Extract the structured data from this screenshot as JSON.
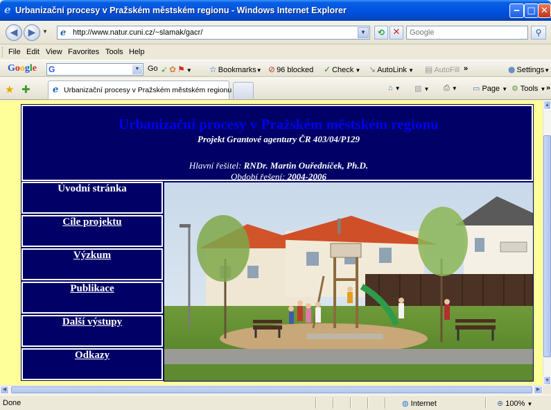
{
  "window": {
    "title": "Urbanizační procesy v Pražském městském regionu - Windows Internet Explorer",
    "minimize": "‒",
    "maximize": "□",
    "close": "✕"
  },
  "address": {
    "url": "http://www.natur.cuni.cz/~slamak/gacr/",
    "search_placeholder": "Google"
  },
  "menu": [
    "File",
    "Edit",
    "View",
    "Favorites",
    "Tools",
    "Help"
  ],
  "google_toolbar": {
    "logo": "Google",
    "go": "Go",
    "bookmarks": "Bookmarks",
    "blocked": "96 blocked",
    "check": "Check",
    "autolink": "AutoLink",
    "autofill": "AutoFill",
    "more": "»",
    "settings": "Settings"
  },
  "tabs": {
    "active_title": "Urbanizační procesy v Pražském městském regionu",
    "page": "Page",
    "tools": "Tools",
    "more": "»"
  },
  "page": {
    "title": "Urbanizační procesy v Pražském městském regionu",
    "subtitle": "Projekt Grantové agentury ČR 403/04/P129",
    "investigator_label": "Hlavní řešitel: ",
    "investigator": "RNDr. Martin Ouředníček, Ph.D.",
    "period_label": "Období řešení: ",
    "period": "2004-2006",
    "nav": [
      {
        "label": "Úvodní stránka"
      },
      {
        "label": "Cíle projektu"
      },
      {
        "label": "Výzkum"
      },
      {
        "label": "Publikace"
      },
      {
        "label": "Další výstupy"
      },
      {
        "label": "Odkazy"
      }
    ]
  },
  "status": {
    "text": "Done",
    "zone": "Internet",
    "zoom": "100%"
  },
  "colors": {
    "titlebar": "#0054e3",
    "page_background": "#ffff99",
    "panel": "#000066",
    "title_text": "#0000ee"
  }
}
